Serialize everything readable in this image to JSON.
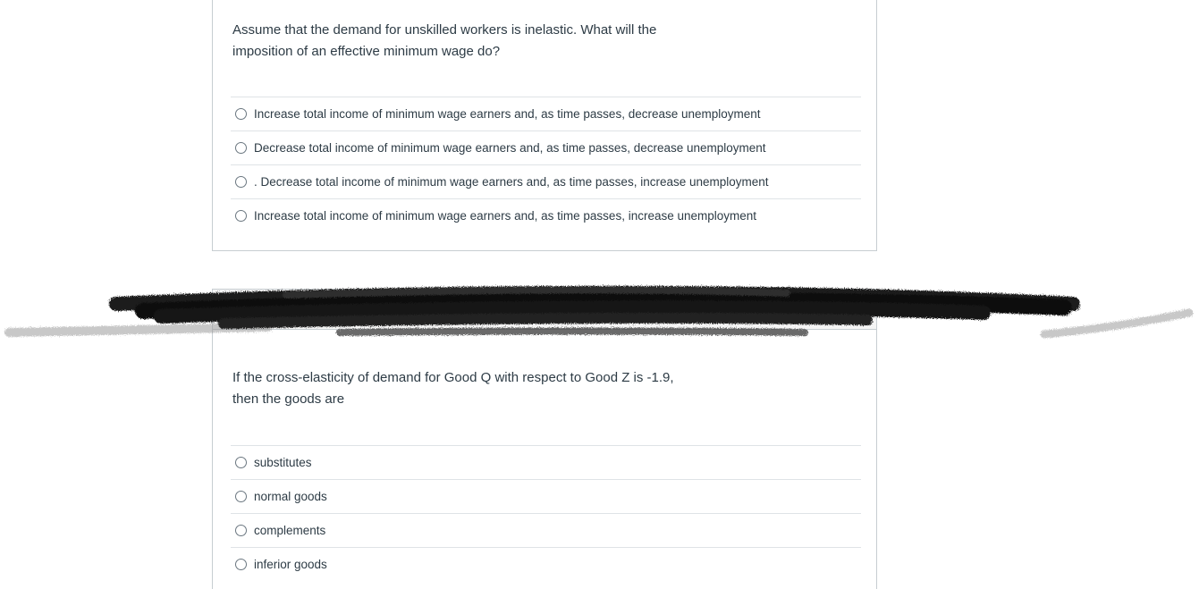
{
  "questions": [
    {
      "text": "Assume that the demand for unskilled workers is inelastic. What will the imposition of an effective minimum wage do?",
      "options": [
        "Increase total income of minimum wage earners and, as time passes, decrease unemployment",
        "Decrease total income of minimum wage earners and, as time passes, decrease unemployment",
        ". Decrease total income of minimum wage earners and, as time passes, increase unemployment",
        "Increase total income of minimum wage earners and, as time passes, increase unemployment"
      ]
    },
    {
      "text": "If the cross-elasticity of demand for Good Q with respect to Good Z is -1.9, then the goods are",
      "options": [
        "substitutes",
        "normal goods",
        "complements",
        "inferior goods"
      ]
    }
  ]
}
